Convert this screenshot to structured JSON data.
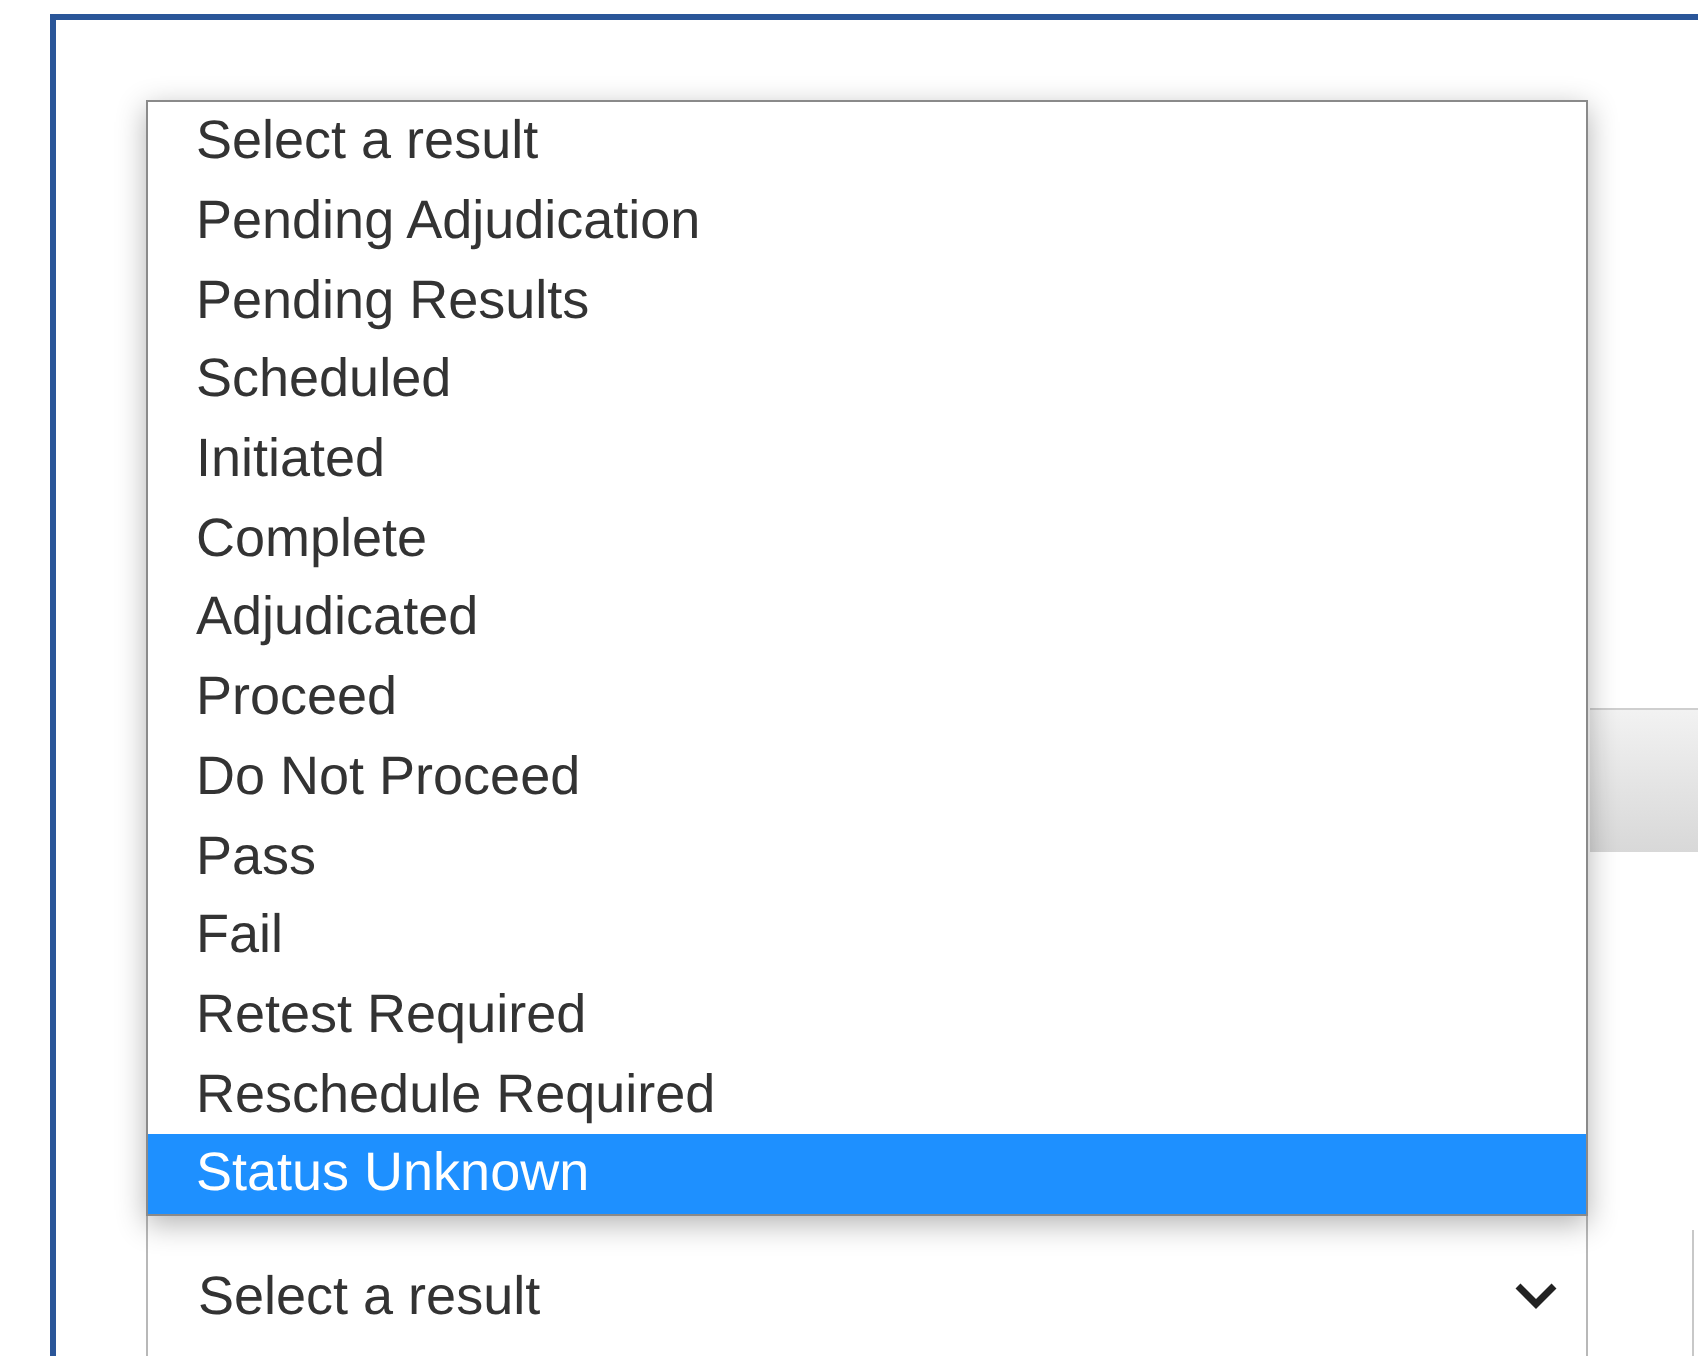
{
  "dropdown": {
    "options": [
      {
        "label": "Select a result",
        "selected": false
      },
      {
        "label": "Pending Adjudication",
        "selected": false
      },
      {
        "label": "Pending Results",
        "selected": false
      },
      {
        "label": "Scheduled",
        "selected": false
      },
      {
        "label": "Initiated",
        "selected": false
      },
      {
        "label": "Complete",
        "selected": false
      },
      {
        "label": "Adjudicated",
        "selected": false
      },
      {
        "label": "Proceed",
        "selected": false
      },
      {
        "label": "Do Not Proceed",
        "selected": false
      },
      {
        "label": "Pass",
        "selected": false
      },
      {
        "label": "Fail",
        "selected": false
      },
      {
        "label": "Retest Required",
        "selected": false
      },
      {
        "label": "Reschedule Required",
        "selected": false
      },
      {
        "label": "Status Unknown",
        "selected": true
      }
    ]
  },
  "select": {
    "value": "Select a result"
  }
}
